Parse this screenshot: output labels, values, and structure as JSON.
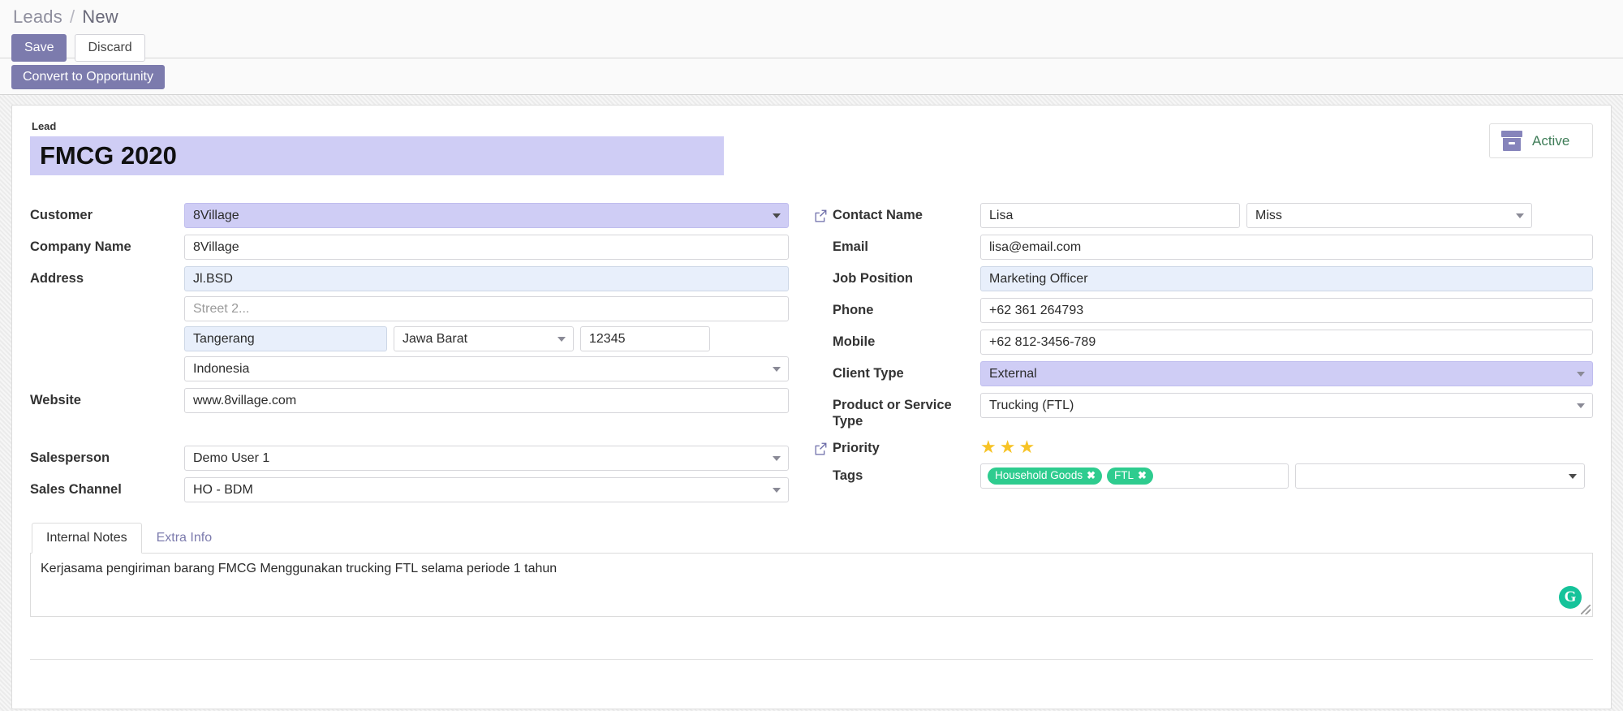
{
  "breadcrumb": {
    "parent": "Leads",
    "separator": "/",
    "current": "New"
  },
  "toolbar": {
    "save_label": "Save",
    "discard_label": "Discard"
  },
  "action_bar": {
    "convert_label": "Convert to Opportunity"
  },
  "status": {
    "label": "Active",
    "icon": "archive-box-icon",
    "color": "#3f7d58",
    "icon_color": "#8684bb"
  },
  "lead": {
    "caption": "Lead",
    "title": "FMCG 2020"
  },
  "left": {
    "customer": {
      "label": "Customer",
      "value": "8Village"
    },
    "company_name": {
      "label": "Company Name",
      "value": "8Village"
    },
    "address": {
      "label": "Address",
      "street": "Jl.BSD",
      "street2_placeholder": "Street 2...",
      "city": "Tangerang",
      "state": "Jawa Barat",
      "zip": "12345",
      "country": "Indonesia"
    },
    "website": {
      "label": "Website",
      "value": "www.8village.com"
    },
    "salesperson": {
      "label": "Salesperson",
      "value": "Demo User 1"
    },
    "sales_channel": {
      "label": "Sales Channel",
      "value": "HO - BDM"
    }
  },
  "right": {
    "contact_name": {
      "label": "Contact Name",
      "value": "Lisa",
      "title": "Miss"
    },
    "email": {
      "label": "Email",
      "value": "lisa@email.com"
    },
    "job_position": {
      "label": "Job Position",
      "value": "Marketing Officer"
    },
    "phone": {
      "label": "Phone",
      "value": "+62 361 264793"
    },
    "mobile": {
      "label": "Mobile",
      "value": "+62 812-3456-789"
    },
    "client_type": {
      "label": "Client Type",
      "value": "External"
    },
    "product_service_type": {
      "label": "Product or Service Type",
      "value": "Trucking (FTL)"
    },
    "priority": {
      "label": "Priority",
      "stars_filled": 3,
      "star_glyph": "★"
    },
    "tags": {
      "label": "Tags",
      "items": [
        {
          "name": "Household Goods",
          "remove": "✖"
        },
        {
          "name": "FTL",
          "remove": "✖"
        }
      ],
      "highlight_color": "#ff0000"
    }
  },
  "notes": {
    "tabs": [
      {
        "label": "Internal Notes",
        "active": true
      },
      {
        "label": "Extra Info",
        "active": false
      }
    ],
    "content": "Kerjasama pengiriman barang FMCG Menggunakan trucking FTL selama periode 1 tahun",
    "grammarly_icon": "G"
  }
}
